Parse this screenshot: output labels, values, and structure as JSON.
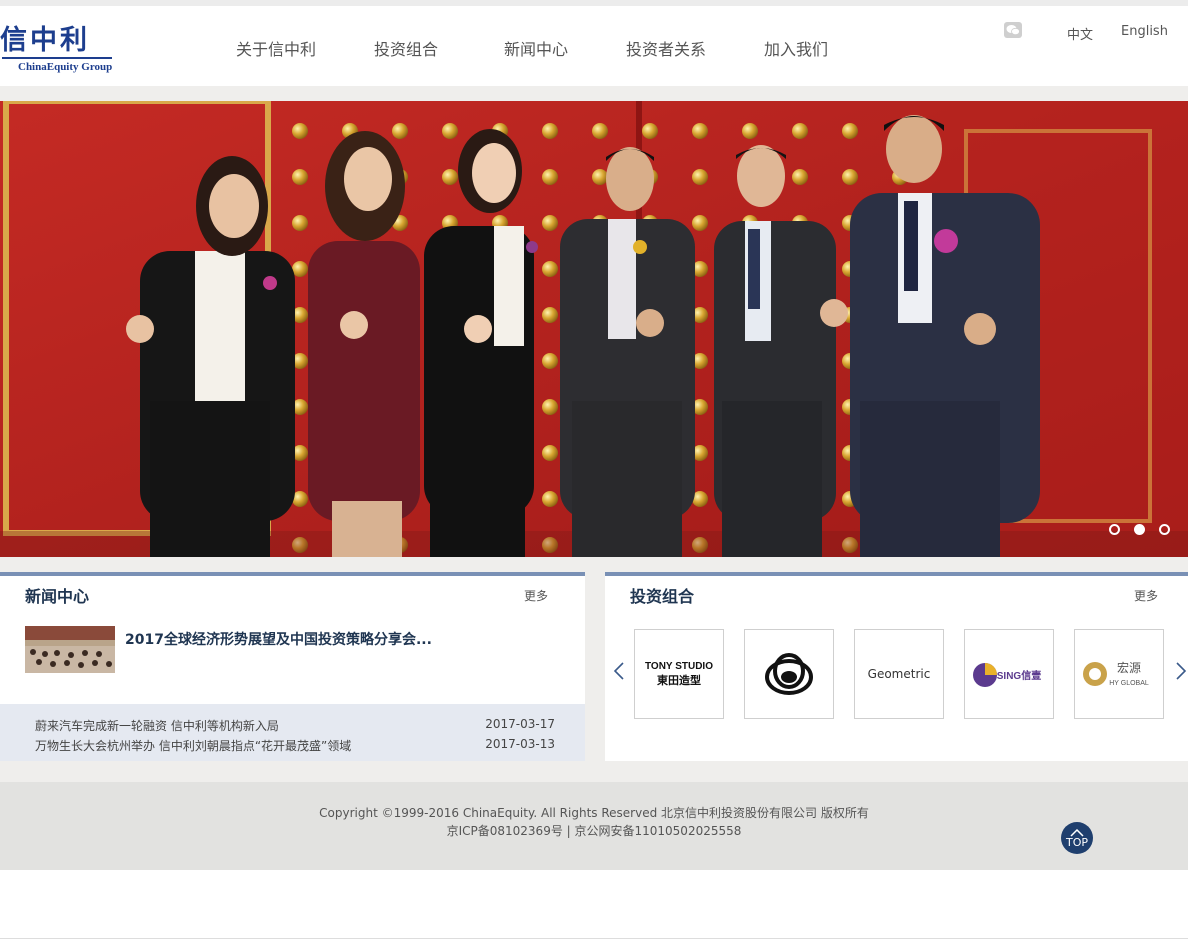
{
  "brand": {
    "logo_cn": "信中利",
    "logo_en": "ChinaEquity Group"
  },
  "nav": {
    "items": [
      "关于信中利",
      "投资组合",
      "新闻中心",
      "投资者关系",
      "加入我们"
    ]
  },
  "header_right": {
    "wechat_icon": "wechat-icon",
    "lang_cn": "中文",
    "lang_en": "English"
  },
  "banner": {
    "slide_count": 3,
    "active_slide": 2,
    "dot_icon": "carousel-dot"
  },
  "news": {
    "title": "新闻中心",
    "more": "更多",
    "featured": "2017全球经济形势展望及中国投资策略分享会...",
    "items": [
      {
        "title": "蔚来汽车完成新一轮融资 信中利等机构新入局",
        "date": "2017-03-17"
      },
      {
        "title": "万物生长大会杭州举办 信中利刘朝晨指点“花开最茂盛”领域",
        "date": "2017-03-13"
      }
    ]
  },
  "portfolio": {
    "title": "投资组合",
    "more": "更多",
    "prev_icon": "chevron-left-icon",
    "next_icon": "chevron-right-icon",
    "logos": [
      {
        "line1": "TONY STUDIO",
        "line2": "東田造型"
      },
      {
        "line1": "",
        "line2": ""
      },
      {
        "line1": "Geometric",
        "line2": ""
      },
      {
        "line1": "SING信壹",
        "line2": ""
      },
      {
        "line1": "宏源",
        "line2": "HY GLOBAL"
      }
    ]
  },
  "footer": {
    "copyright": "Copyright ©1999-2016 ChinaEquity. All Rights Reserved 北京信中利投资股份有限公司 版权所有",
    "icp": "京ICP备08102369号  |  京公网安备11010502025558",
    "top_label": "TOP"
  },
  "colors": {
    "brand_blue": "#1d3e8e",
    "panel_rule": "#7990b5",
    "banner_red": "#b3201e",
    "top_button": "#1f3f6e"
  }
}
